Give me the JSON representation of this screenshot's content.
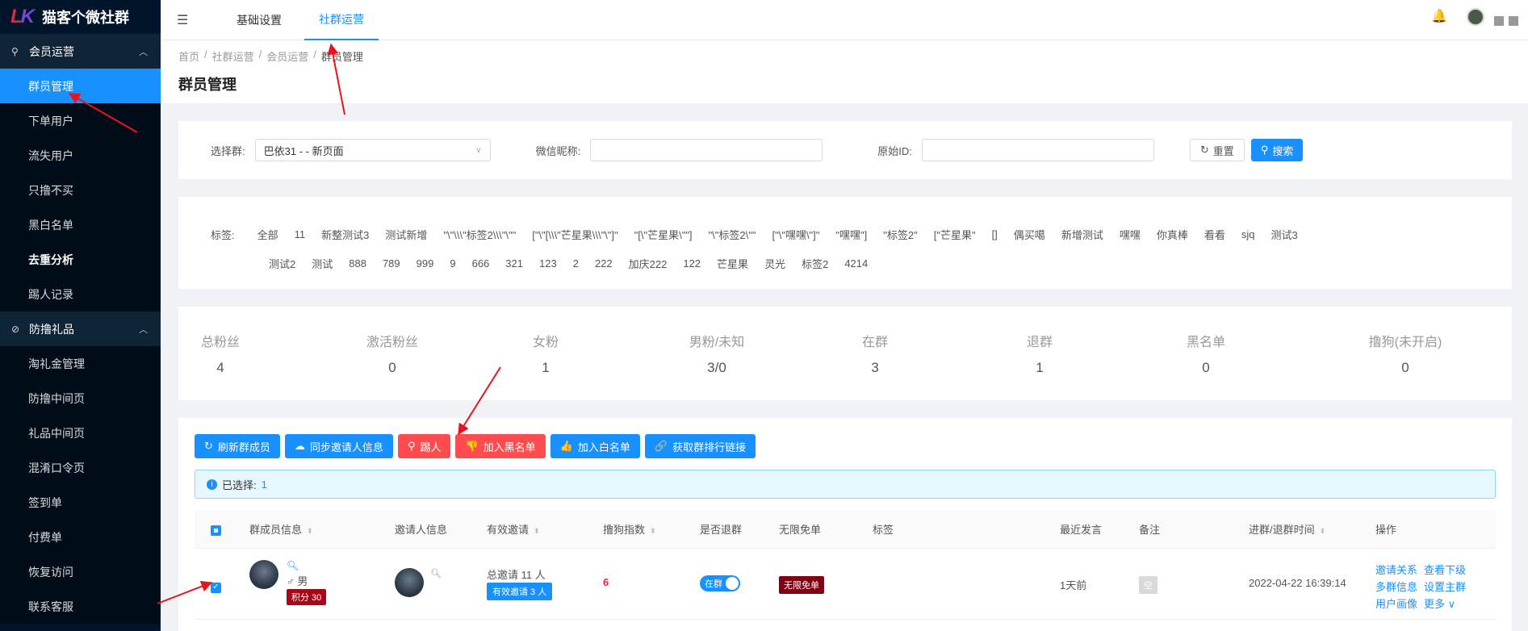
{
  "app": {
    "name": "猫客个微社群",
    "logo": "LK"
  },
  "sidebar": {
    "groups": [
      {
        "label": "会员运营",
        "icon": "user-group-icon",
        "items": [
          "群员管理",
          "下单用户",
          "流失用户",
          "只撸不买",
          "黑白名单",
          "去重分析",
          "踢人记录"
        ]
      },
      {
        "label": "防撸礼品",
        "icon": "eye-off-icon",
        "items": [
          "淘礼金管理",
          "防撸中间页",
          "礼品中间页",
          "混淆口令页",
          "签到单",
          "付费单",
          "恢复访问",
          "联系客服"
        ]
      }
    ],
    "active": "群员管理"
  },
  "topbar": {
    "tabs": [
      "基础设置",
      "社群运营"
    ],
    "active": "社群运营"
  },
  "breadcrumb": [
    "首页",
    "社群运营",
    "会员运营",
    "群员管理"
  ],
  "page_title": "群员管理",
  "filter": {
    "group_label": "选择群:",
    "group_value": "巴依31 - - 新页面",
    "nickname_label": "微信昵称:",
    "nickname_value": "",
    "rawid_label": "原始ID:",
    "rawid_value": "",
    "reset_label": "重置",
    "search_label": "搜索"
  },
  "tags": {
    "label": "标签:",
    "row1": [
      "全部",
      "11",
      "新整测试3",
      "测试新增",
      "\"\\\"\\\\\\\"标签2\\\\\\\"\\\"\"",
      "[\"\\\"[\\\\\\\"芒星果\\\\\\\"\\\"]\"",
      "\"[\\\"芒星果\\\"\"]",
      "\"\\\"标签2\\\"\"",
      "[\"\\\"嘿嘿\\\"]\"",
      "\"嘿嘿\"]",
      "\"标签2\"",
      "[\"芒星果\"",
      "[]",
      "偶买噶",
      "新增测试",
      "嘿嘿",
      "你真棒",
      "看看",
      "sjq",
      "测试3"
    ],
    "row2": [
      "测试2",
      "测试",
      "888",
      "789",
      "999",
      "9",
      "666",
      "321",
      "123",
      "2",
      "222",
      "加庆222",
      "122",
      "芒星果",
      "灵光",
      "标签2",
      "4214"
    ]
  },
  "stats": [
    {
      "label": "总粉丝",
      "value": "4"
    },
    {
      "label": "激活粉丝",
      "value": "0"
    },
    {
      "label": "女粉",
      "value": "1"
    },
    {
      "label": "男粉/未知",
      "value": "3/0"
    },
    {
      "label": "在群",
      "value": "3"
    },
    {
      "label": "退群",
      "value": "1"
    },
    {
      "label": "黑名单",
      "value": "0"
    },
    {
      "label": "撸狗(未开启)",
      "value": "0"
    }
  ],
  "actions": {
    "refresh": "刷新群成员",
    "sync": "同步邀请人信息",
    "kick": "踢人",
    "blacklist": "加入黑名单",
    "whitelist": "加入白名单",
    "rank_link": "获取群排行链接"
  },
  "selection": {
    "label": "已选择:",
    "count": "1"
  },
  "table": {
    "headers": {
      "member": "群成员信息",
      "inviter": "邀请人信息",
      "valid_invite": "有效邀请",
      "lu_index": "撸狗指数",
      "left": "是否退群",
      "free": "无限免单",
      "tag": "标签",
      "last_speak": "最近发言",
      "remark": "备注",
      "time": "进群/退群时间",
      "ops": "操作"
    },
    "rows": [
      {
        "gender": "♂ 男",
        "score": "积分 30",
        "total_invite": "总邀请 11 人",
        "valid_invite": "有效邀请 3 人",
        "lu_index": "6",
        "in_group": "在群",
        "free": "无限免单",
        "last_speak": "1天前",
        "remark": "空",
        "time": "2022-04-22 16:39:14",
        "ops": [
          "邀请关系",
          "查看下级",
          "多群信息",
          "设置主群",
          "用户画像",
          "更多 ∨"
        ]
      }
    ]
  },
  "colors": {
    "primary": "#1890ff",
    "danger": "#ff4d4f",
    "sidebar": "#001529",
    "annotation": "#e8131f"
  }
}
